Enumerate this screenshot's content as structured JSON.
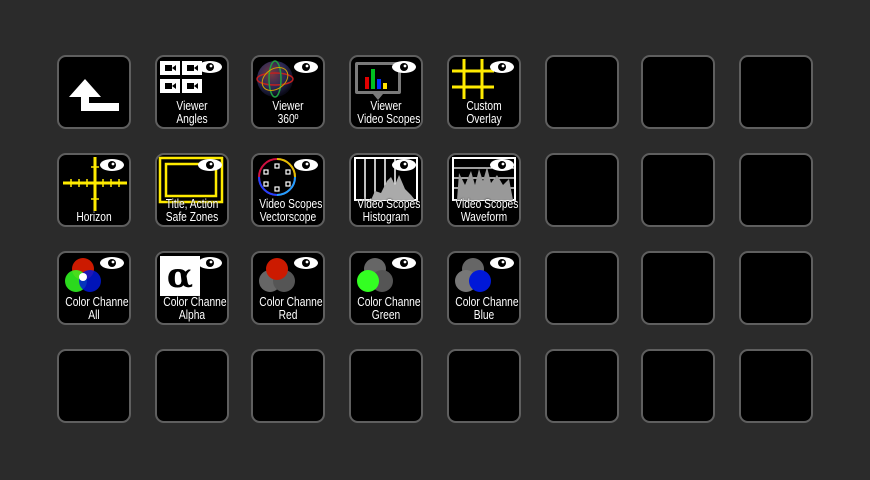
{
  "keys": [
    {
      "id": "back",
      "icon": "back-arrow-icon",
      "line1": "",
      "line2": ""
    },
    {
      "id": "viewer-angles",
      "icon": "camera-grid-icon",
      "line1": "Viewer",
      "line2": "Angles",
      "eye": true
    },
    {
      "id": "viewer-360",
      "icon": "sphere-icon",
      "line1": "Viewer",
      "line2": "360º",
      "eye": true
    },
    {
      "id": "viewer-video-scopes",
      "icon": "scope-monitor-icon",
      "line1": "Viewer",
      "line2": "Video Scopes",
      "eye": true
    },
    {
      "id": "custom-overlay",
      "icon": "grid-overlay-icon",
      "line1": "Custom",
      "line2": "Overlay",
      "eye": true
    },
    {
      "id": "horizon",
      "icon": "horizon-icon",
      "line1": "",
      "line2": "Horizon",
      "eye": true
    },
    {
      "id": "safe-zones",
      "icon": "safe-zones-icon",
      "line1": "Title, Action",
      "line2": "Safe Zones",
      "eye": true
    },
    {
      "id": "vectorscope",
      "icon": "vectorscope-icon",
      "line1": "Video Scopes",
      "line2": "Vectorscope",
      "eye": true
    },
    {
      "id": "histogram",
      "icon": "histogram-icon",
      "line1": "Video Scopes",
      "line2": "Histogram",
      "eye": true
    },
    {
      "id": "waveform",
      "icon": "waveform-icon",
      "line1": "Video Scopes",
      "line2": "Waveform",
      "eye": true
    },
    {
      "id": "channel-all",
      "icon": "rgb-circles-icon",
      "line1": "Color Channel",
      "line2": "All",
      "eye": true
    },
    {
      "id": "channel-alpha",
      "icon": "alpha-icon",
      "line1": "Color Channel",
      "line2": "Alpha",
      "eye": true,
      "glyph": "α"
    },
    {
      "id": "channel-red",
      "icon": "red-channel-icon",
      "line1": "Color Channel",
      "line2": "Red",
      "eye": true
    },
    {
      "id": "channel-green",
      "icon": "green-channel-icon",
      "line1": "Color Channel",
      "line2": "Green",
      "eye": true
    },
    {
      "id": "channel-blue",
      "icon": "blue-channel-icon",
      "line1": "Color Channel",
      "line2": "Blue",
      "eye": true
    }
  ],
  "colors": {
    "background": "#2b2b2b",
    "key_border": "#5f5f5f",
    "overlay_yellow": "#ffeb00",
    "red": "#cc1a00",
    "green": "#33ff22",
    "blue": "#0018d8"
  }
}
